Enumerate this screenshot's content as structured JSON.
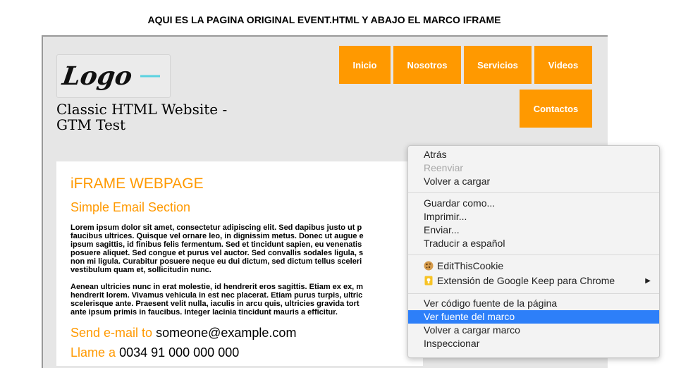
{
  "heading": "AQUI ES LA PAGINA ORIGINAL EVENT.HTML Y ABAJO EL MARCO IFRAME",
  "site": {
    "logo_text": "Logo",
    "title": "Classic HTML Website - GTM Test"
  },
  "nav": {
    "items": [
      "Inicio",
      "Nosotros",
      "Servicios",
      "Videos",
      "Contactos"
    ]
  },
  "content": {
    "title": "iFRAME WEBPAGE",
    "subtitle": "Simple Email Section",
    "paragraph1": [
      "Lorem ipsum dolor sit amet, consectetur adipiscing elit. Sed dapibus justo ut p",
      "faucibus ultrices. Quisque vel ornare leo, in dignissim metus. Donec ut augue e",
      "ipsum sagittis, id finibus felis fermentum. Sed et tincidunt sapien, eu venenatis",
      "posuere aliquet. Sed congue et purus vel auctor. Sed convallis sodales ligula, s",
      "non mi ligula. Curabitur posuere neque eu dui dictum, sed dictum tellus sceleri",
      "vestibulum quam et, sollicitudin nunc."
    ],
    "paragraph2": [
      "Aenean ultricies nunc in erat molestie, id hendrerit eros sagittis. Etiam ex ex, m",
      "hendrerit lorem. Vivamus vehicula in est nec placerat. Etiam purus turpis, ultric",
      "scelerisque ante. Praesent velit nulla, iaculis in arcu quis, ultricies gravida tort",
      "ante ipsum primis in faucibus. Integer lacinia tincidunt mauris a efficitur."
    ],
    "send_label": "Send e-mail to",
    "send_value": "someone@example.com",
    "call_label": "Llame a",
    "call_value": "0034 91 000 000 000"
  },
  "context_menu": {
    "back": "Atrás",
    "forward": "Reenviar",
    "reload": "Volver a cargar",
    "save_as": "Guardar como...",
    "print": "Imprimir...",
    "send": "Enviar...",
    "translate": "Traducir a español",
    "editthiscookie": "EditThisCookie",
    "google_keep": "Extensión de Google Keep para Chrome",
    "view_source": "Ver código fuente de la página",
    "view_frame_source": "Ver fuente del marco",
    "reload_frame": "Volver a cargar marco",
    "inspect": "Inspeccionar"
  },
  "colors": {
    "accent": "#ff9900",
    "menu_highlight": "#2d7ff9"
  },
  "icons": {
    "cookie": "cookie-icon",
    "keep": "google-keep-icon",
    "submenu": "chevron-right-icon"
  }
}
